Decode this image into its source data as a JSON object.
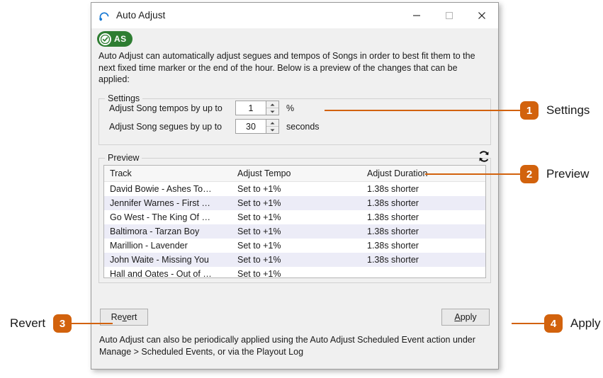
{
  "window": {
    "title": "Auto Adjust",
    "icon": "headphones-icon",
    "controls": {
      "minimize": "minimize-icon",
      "maximize": "maximize-icon",
      "close": "close-icon"
    }
  },
  "badge": {
    "text": "AS",
    "color": "#2e7d32"
  },
  "intro": "Auto Adjust can automatically adjust segues and tempos of Songs in order to best fit them to the next fixed time marker or the end of the hour. Below is a preview of the changes that can be applied:",
  "settings": {
    "title": "Settings",
    "rows": [
      {
        "label": "Adjust Song tempos by up to",
        "value": "1",
        "unit": "%"
      },
      {
        "label": "Adjust Song segues by up to",
        "value": "30",
        "unit": "seconds"
      }
    ]
  },
  "preview": {
    "title": "Preview",
    "refresh_icon": "refresh-icon",
    "columns": [
      "Track",
      "Adjust Tempo",
      "Adjust Duration"
    ],
    "rows": [
      {
        "track": "David Bowie - Ashes To…",
        "tempo": "Set to +1%",
        "duration": "1.38s shorter"
      },
      {
        "track": "Jennifer Warnes - First …",
        "tempo": "Set to +1%",
        "duration": "1.38s shorter"
      },
      {
        "track": "Go West - The King Of …",
        "tempo": "Set to +1%",
        "duration": "1.38s shorter"
      },
      {
        "track": "Baltimora - Tarzan Boy",
        "tempo": "Set to +1%",
        "duration": "1.38s shorter"
      },
      {
        "track": "Marillion - Lavender",
        "tempo": "Set to +1%",
        "duration": "1.38s shorter"
      },
      {
        "track": "John Waite - Missing You",
        "tempo": "Set to +1%",
        "duration": "1.38s shorter"
      },
      {
        "track": "Hall and Oates - Out of …",
        "tempo": "Set to +1%",
        "duration": ""
      }
    ]
  },
  "footer": {
    "revert": {
      "pre": "Re",
      "mnemonic": "v",
      "post": "ert"
    },
    "apply": {
      "pre": "",
      "mnemonic": "A",
      "post": "pply"
    },
    "note": "Auto Adjust can also be periodically applied using the Auto Adjust Scheduled Event action under Manage > Scheduled Events, or via the Playout Log"
  },
  "callouts": [
    {
      "number": "1",
      "label": "Settings"
    },
    {
      "number": "2",
      "label": "Preview"
    },
    {
      "number": "3",
      "label": "Revert"
    },
    {
      "number": "4",
      "label": "Apply"
    }
  ],
  "accent_color": "#d2620d"
}
